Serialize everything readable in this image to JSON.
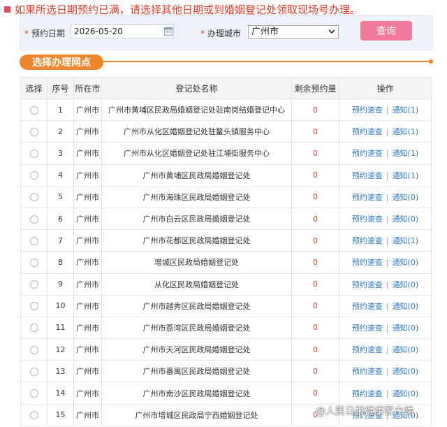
{
  "notice": "如果所选日期预约已满，请选择其他日期或到婚姻登记处领取现场号办理。",
  "search": {
    "date_label": "预约日期",
    "date_value": "2026-05-20",
    "city_label": "办理城市",
    "city_value": "广州市",
    "query_button": "查询"
  },
  "section_title": "选择办理网点",
  "table": {
    "headers": [
      "选择",
      "序号",
      "所在市",
      "登记处名称",
      "剩余预约量",
      "操作"
    ],
    "action_primary": "预约速查",
    "rows": [
      {
        "no": "1",
        "city": "广州市",
        "name": "广州市黄埔区民政局婚姻登记处驻南岗结婚登记中心",
        "remain": "0",
        "notice": "通知(1)"
      },
      {
        "no": "2",
        "city": "广州市",
        "name": "广州市从化区婚姻登记处驻鳌头镇服务中心",
        "remain": "0",
        "notice": "通知(1)"
      },
      {
        "no": "3",
        "city": "广州市",
        "name": "广州市从化区婚姻登记处驻江埔街服务中心",
        "remain": "0",
        "notice": "通知(1)"
      },
      {
        "no": "4",
        "city": "广州市",
        "name": "广州市黄埔区民政局婚姻登记处",
        "remain": "0",
        "notice": "通知(1)"
      },
      {
        "no": "5",
        "city": "广州市",
        "name": "广州市海珠区民政局婚姻登记处",
        "remain": "0",
        "notice": "通知(0)"
      },
      {
        "no": "6",
        "city": "广州市",
        "name": "广州市白云区民政局婚姻登记处",
        "remain": "0",
        "notice": "通知(0)"
      },
      {
        "no": "7",
        "city": "广州市",
        "name": "广州市花都区民政局婚姻登记处",
        "remain": "0",
        "notice": "通知(1)"
      },
      {
        "no": "8",
        "city": "广州市",
        "name": "增城区民政局婚姻登记处",
        "remain": "0",
        "notice": "通知(0)"
      },
      {
        "no": "9",
        "city": "广州市",
        "name": "从化区民政局婚姻登记处",
        "remain": "0",
        "notice": "通知(0)"
      },
      {
        "no": "10",
        "city": "广州市",
        "name": "广州市越秀区民政局婚姻登记处",
        "remain": "0",
        "notice": "通知(0)"
      },
      {
        "no": "11",
        "city": "广州市",
        "name": "广州市荔湾区民政局婚姻登记处",
        "remain": "0",
        "notice": "通知(0)"
      },
      {
        "no": "12",
        "city": "广州市",
        "name": "广州市天河区民政局婚姻登记处",
        "remain": "0",
        "notice": "通知(0)"
      },
      {
        "no": "13",
        "city": "广州市",
        "name": "广州市番禺区民政局婚姻登记处",
        "remain": "0",
        "notice": "通知(0)"
      },
      {
        "no": "14",
        "city": "广州市",
        "name": "广州市南沙区民政局婚姻登记处",
        "remain": "0",
        "notice": "通知(0)"
      },
      {
        "no": "15",
        "city": "广州市",
        "name": "广州市增城区民政局宁西婚姻登记处",
        "remain": "0",
        "notice": "通知(0)"
      }
    ]
  },
  "watermark": "@人民日报健康客户端"
}
